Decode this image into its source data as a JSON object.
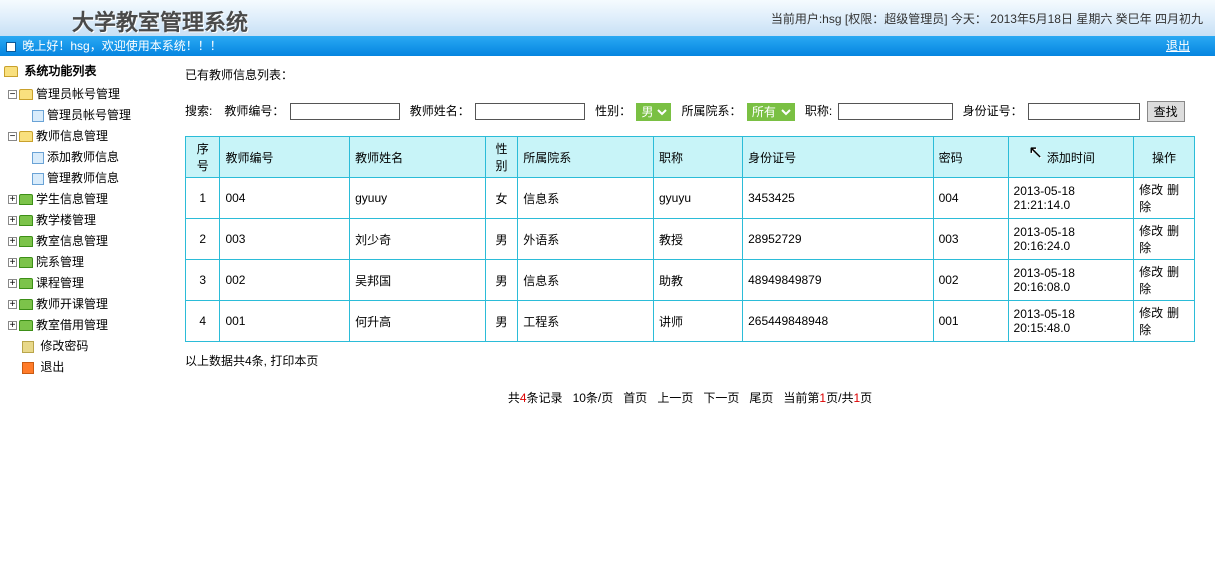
{
  "header": {
    "app_title": "大学教室管理系统",
    "status_prefix": "当前用户:",
    "username": "hsg",
    "role_prefix": "[权限：",
    "role": "超级管理员",
    "role_suffix": "]",
    "today_prefix": "今天：",
    "today_date": "2013年5月18日 星期六 癸巳年 四月初九"
  },
  "greet": {
    "text": "晚上好！hsg，欢迎使用本系统！！！",
    "logout": "退出"
  },
  "sidebar": {
    "root": "系统功能列表",
    "items": [
      {
        "label": "管理员帐号管理",
        "expanded": true,
        "children": [
          {
            "label": "管理员帐号管理"
          }
        ]
      },
      {
        "label": "教师信息管理",
        "expanded": true,
        "children": [
          {
            "label": "添加教师信息"
          },
          {
            "label": "管理教师信息"
          }
        ]
      },
      {
        "label": "学生信息管理",
        "expanded": false
      },
      {
        "label": "教学楼管理",
        "expanded": false
      },
      {
        "label": "教室信息管理",
        "expanded": false
      },
      {
        "label": "院系管理",
        "expanded": false
      },
      {
        "label": "课程管理",
        "expanded": false
      },
      {
        "label": "教师开课管理",
        "expanded": false
      },
      {
        "label": "教室借用管理",
        "expanded": false
      }
    ],
    "change_pw": "修改密码",
    "logout": "退出"
  },
  "main": {
    "list_label": "已有教师信息列表：",
    "search": {
      "label": "搜索:",
      "teacher_no_label": "教师编号：",
      "teacher_name_label": "教师姓名：",
      "gender_label": "性别：",
      "gender_value": "男",
      "dept_label": "所属院系：",
      "dept_value": "所有",
      "title_label": "职称:",
      "idcard_label": "身份证号：",
      "search_btn": "查找"
    },
    "columns": [
      "序号",
      "教师编号",
      "教师姓名",
      "性别",
      "所属院系",
      "职称",
      "身份证号",
      "密码",
      "添加时间",
      "操作"
    ],
    "rows": [
      {
        "idx": "1",
        "no": "004",
        "name": "gyuuy",
        "gender": "女",
        "dept": "信息系",
        "title": "gyuyu",
        "idcard": "3453425",
        "pwd": "004",
        "time": "2013-05-18 21:21:14.0"
      },
      {
        "idx": "2",
        "no": "003",
        "name": "刘少奇",
        "gender": "男",
        "dept": "外语系",
        "title": "教授",
        "idcard": "28952729",
        "pwd": "003",
        "time": "2013-05-18 20:16:24.0"
      },
      {
        "idx": "3",
        "no": "002",
        "name": "吴邦国",
        "gender": "男",
        "dept": "信息系",
        "title": "助教",
        "idcard": "48949849879",
        "pwd": "002",
        "time": "2013-05-18 20:16:08.0"
      },
      {
        "idx": "4",
        "no": "001",
        "name": "何升高",
        "gender": "男",
        "dept": "工程系",
        "title": "讲师",
        "idcard": "265449848948",
        "pwd": "001",
        "time": "2013-05-18 20:15:48.0"
      }
    ],
    "op_edit": "修改",
    "op_del": "删除",
    "footer_note": "以上数据共4条, 打印本页",
    "pager": {
      "total_prefix": "共",
      "total_count": "4",
      "total_suffix": "条记录",
      "per_page": "10条/页",
      "first": "首页",
      "prev": "上一页",
      "next": "下一页",
      "last": "尾页",
      "cur_prefix": "当前第",
      "cur_page": "1",
      "cur_mid": "页/共",
      "total_pages": "1",
      "cur_suffix": "页"
    }
  }
}
